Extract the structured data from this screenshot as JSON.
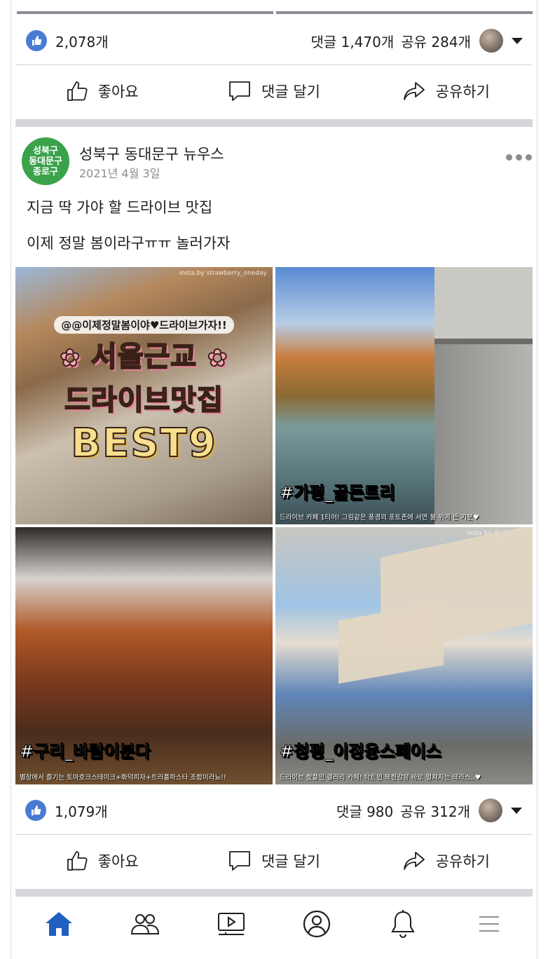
{
  "previous_post": {
    "reactions": {
      "like_count": "2,078개"
    },
    "comments_label": "댓글 1,470개",
    "shares_label": "공유 284개"
  },
  "actions": {
    "like_label": "좋아요",
    "comment_label": "댓글 달기",
    "share_label": "공유하기"
  },
  "post": {
    "page_name": "성북구 동대문구 뉴우스",
    "avatar_text_lines": [
      "성북구",
      "동대문구",
      "종로구"
    ],
    "date": "2021년 4월 3일",
    "text_line_1": "지금 딱 가야 할 드라이브 맛집",
    "text_line_2": "이제 정말 봄이라구ㅠㅠ 놀러가자",
    "images": [
      {
        "subtitle": "@@이제정말봄이야♥드라이브가자!!",
        "headline_1": "서울근교",
        "headline_2": "드라이브맛집",
        "headline_3": "BEST9",
        "watermark": "insta.by strawberry_oneday"
      },
      {
        "tag": "#가평_골든트리",
        "caption": "드라이브 카페 1티어! 그림같은 풍경의 포토존에 서면 물 위에 뜬 기분♥"
      },
      {
        "tag": "#구리_바람이분다",
        "caption": "별장에서 즐기는 토마호크스테이크+화덕피자+트러플파스타 조합이라뇨!!"
      },
      {
        "tag": "#청평_이정웅스페이스",
        "caption": "드라이브 핫플인 갤러리 카페! 탁트인 북한강뷰 바로 펼쳐지는 테라스..♥",
        "watermark": "insta by @_hae323"
      }
    ],
    "reactions": {
      "like_count": "1,079개"
    },
    "comments_label": "댓글 980",
    "shares_label": "공유 312개"
  },
  "bottom_nav": {
    "items": [
      "home-icon",
      "friends-icon",
      "watch-icon",
      "profile-icon",
      "notifications-icon",
      "menu-icon"
    ],
    "active_color": "#1f5fbf"
  },
  "colors": {
    "like_badge": "#4a7bd3",
    "page_avatar": "#3aa24a",
    "section_gap": "#d6d7da"
  }
}
